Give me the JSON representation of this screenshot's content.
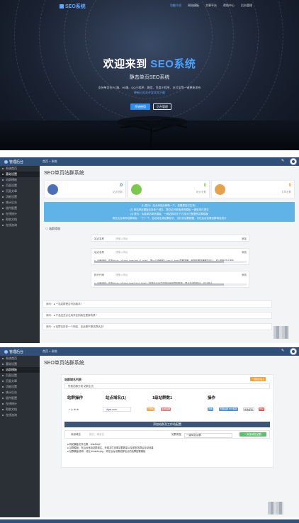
{
  "hero": {
    "logo": "SEO系统",
    "nav": [
      "功能介绍",
      "网站模板",
      "文章平台",
      "帮助中心",
      "后台管理"
    ],
    "title_prefix": "欢迎来到 ",
    "title_brand": "SEO系统",
    "subtitle": "静态单页SEO系统",
    "desc": "支持单页在PC端、H5端、QQ小程序、微信、百度小程序、支付宝等一键更新发布",
    "link": "更新日志及开发文档下载",
    "btn_primary": "开始使用",
    "btn_secondary": "后台管理"
  },
  "topbar": {
    "brand": "管理后台",
    "crumb": "首页  >  系统",
    "edit_icon": "✎"
  },
  "sidebar": [
    "系统首页",
    "基础设置",
    "站群模板",
    "页面设置",
    "页面文章",
    "功能设置",
    "统计后台",
    "插件配置",
    "在线统计",
    "帮助文档",
    "在线咨询"
  ],
  "dashboard": {
    "title": "SEO单页站群系统",
    "stats": [
      {
        "value": "0",
        "label": "站点总数",
        "color": "#4c6fb5"
      },
      {
        "value": "0",
        "label": "统计总数",
        "color": "#7bc94a"
      },
      {
        "value": "0",
        "label": "文章总数",
        "color": "#e6a24a"
      }
    ],
    "notice": [
      "(1) 提示：站点添加后刷新一下，查看是否已生效！",
      "(2) 单站单页模板支持多个域名，提交后可单独修改模板 一键收录已提交",
      "(3) 提示：功能单站单页模板，一键站群可在下方显示已配置的站群模板",
      "请在后台填写站群域名：一行一个，会自动生成站群统计，支持多站群配置，可在后台查看站群域名统计"
    ],
    "section": "站群添加",
    "forms": [
      {
        "label": "站点名称",
        "placeholder": "请输入网址",
        "tail": "添加",
        "code": "",
        "bar": false
      },
      {
        "label": "站点名称",
        "placeholder": "请输入网址",
        "tail": "添加",
        "code": "● 示例代码：请写http://bing.com/api/1.html，把一个页面放入/api1.html的服务器，就是在服务器都会可以，可以替代站点添加",
        "bar": true
      },
      {
        "label": "统计代码",
        "placeholder": "请输入网址",
        "tail": "添加",
        "code": "● 示例代码：请写http://bing.com/id=1.html，在统计后台生成统计代码复制粘贴，再点击添加统计，可以统计",
        "bar": true
      }
    ],
    "faqs": [
      "请问：● 一站站群是否可用版本?",
      "请问：● 产品这些点击用来定制我在更新收录?",
      "请问：● 站群支持多一个网站，至此是不是站群站点?"
    ]
  },
  "sites": {
    "title": "SEO单页站群系统",
    "card_title": "站群域名列表",
    "badge": "一键添加站点",
    "select": "所属站群分类    站群主页",
    "headers": [
      "站群操作",
      "站点域名(1)",
      "1级站群数1",
      "操作"
    ],
    "row": {
      "ops": "+  ◎  ⊕  ⊗",
      "domain": "diyst.com",
      "chip1": "已添加",
      "chip2": "生成站群",
      "btn_view": "查看",
      "btn_edit": "管理站群 /PC/移动",
      "btn_del": "修改配置",
      "btn_red": "删除"
    },
    "add_bar": "添加站群及工作站配置",
    "add_label": "添加域名",
    "add_placeholder": "格式：域名名",
    "add_type": "站群类型",
    "add_type_value": "一级域名站群",
    "add_btn": "+ 添加域名站群",
    "help": [
      "● 网站模板文件位置：/site/tmpl/",
      "● 站群模板：在后台添加站群域名，在域名栏设置站群数量以及类型站群后自动创建",
      "● 站群模板说明：请在 thinkids.php，并在后台设置站群站点的站群配置模板"
    ]
  }
}
